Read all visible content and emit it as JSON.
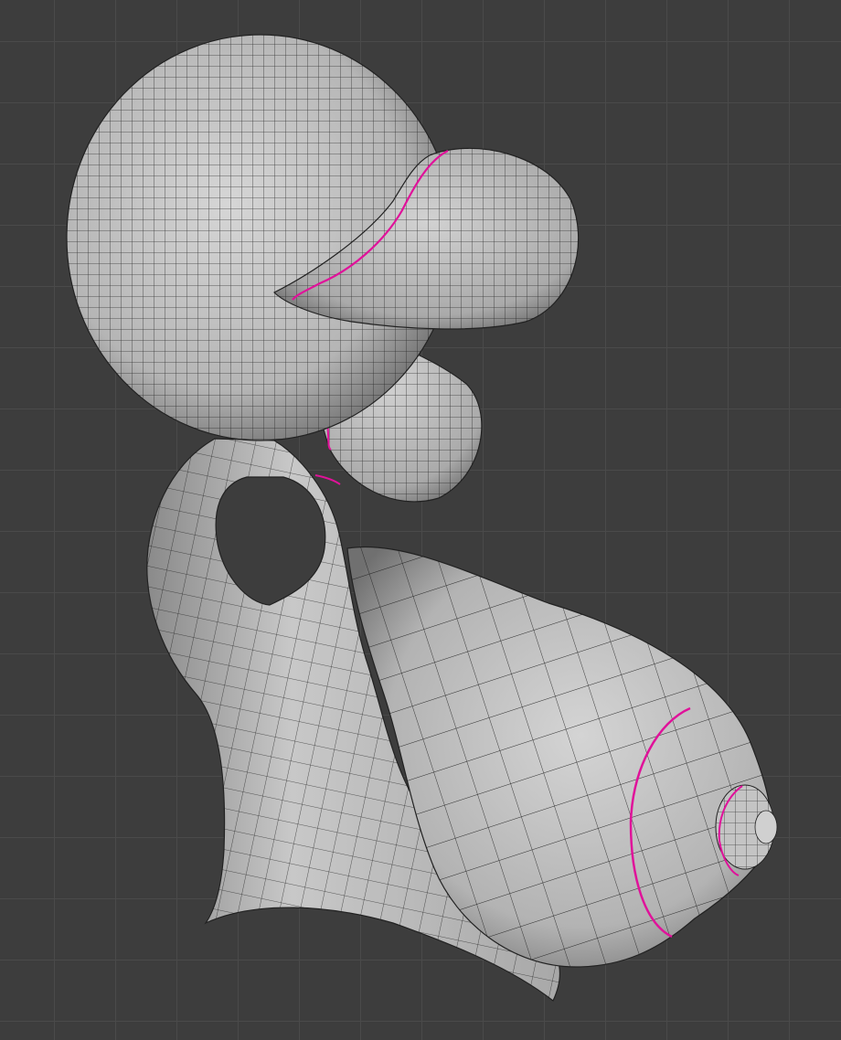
{
  "viewport": {
    "background": "#3d3d3d",
    "grid_color": "#4a4a4a"
  },
  "mesh": {
    "surface_color": "#c9c9c9",
    "wire_color": "#1c1c1c",
    "seam_color": "#e0129a",
    "shading": "solid"
  },
  "icons": {
    "mesh": "sculpt-mesh-icon"
  }
}
